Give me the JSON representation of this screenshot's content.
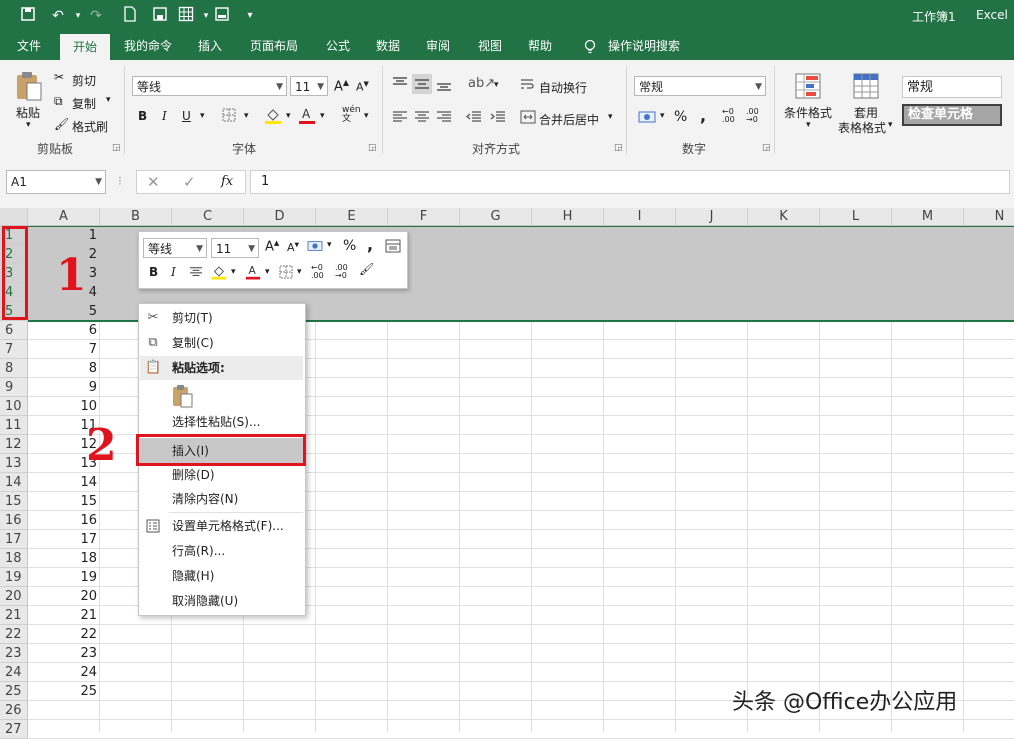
{
  "window": {
    "doc_title": "工作簿1",
    "app_name": "Excel"
  },
  "quick_access": {
    "save": "save",
    "undo": "undo",
    "redo": "redo"
  },
  "tabs": [
    {
      "label": "文件"
    },
    {
      "label": "开始"
    },
    {
      "label": "我的命令"
    },
    {
      "label": "插入"
    },
    {
      "label": "页面布局"
    },
    {
      "label": "公式"
    },
    {
      "label": "数据"
    },
    {
      "label": "审阅"
    },
    {
      "label": "视图"
    },
    {
      "label": "帮助"
    }
  ],
  "tell_me": "操作说明搜索",
  "ribbon": {
    "clipboard": {
      "paste": "粘贴",
      "cut": "剪切",
      "copy": "复制",
      "format_painter": "格式刷",
      "label": "剪贴板"
    },
    "font": {
      "name": "等线",
      "size": "11",
      "bold": "B",
      "italic": "I",
      "underline": "U",
      "label": "字体"
    },
    "alignment": {
      "wrap": "自动换行",
      "merge": "合并后居中",
      "label": "对齐方式"
    },
    "number": {
      "format": "常规",
      "percent": "%",
      "comma": ",",
      "label": "数字"
    },
    "styles": {
      "conditional": "条件格式",
      "table_line1": "套用",
      "table_line2": "表格格式",
      "style_normal": "常规",
      "style_check": "检查单元格"
    }
  },
  "formula_bar": {
    "name_box": "A1",
    "fx": "fx",
    "value": "1"
  },
  "columns": [
    "A",
    "B",
    "C",
    "D",
    "E",
    "F",
    "G",
    "H",
    "I",
    "J",
    "K",
    "L",
    "M",
    "N"
  ],
  "rows": [
    "1",
    "2",
    "3",
    "4",
    "5",
    "6",
    "7",
    "8",
    "9",
    "10",
    "11",
    "12",
    "13",
    "14",
    "15",
    "16",
    "17",
    "18",
    "19",
    "20",
    "21",
    "22",
    "23",
    "24",
    "25",
    "26",
    "27"
  ],
  "col_a_values": [
    "1",
    "2",
    "3",
    "4",
    "5",
    "6",
    "7",
    "8",
    "9",
    "10",
    "11",
    "12",
    "13",
    "14",
    "15",
    "16",
    "17",
    "18",
    "19",
    "20",
    "21",
    "22",
    "23",
    "24",
    "25",
    "",
    ""
  ],
  "mini_toolbar": {
    "font": "等线",
    "size": "11",
    "bold": "B",
    "italic": "I",
    "percent": "%",
    "comma": ","
  },
  "context_menu": {
    "cut": "剪切(T)",
    "copy": "复制(C)",
    "paste_options": "粘贴选项:",
    "paste_special": "选择性粘贴(S)...",
    "insert": "插入(I)",
    "delete": "删除(D)",
    "clear": "清除内容(N)",
    "format_cells": "设置单元格格式(F)...",
    "row_height": "行高(R)...",
    "hide": "隐藏(H)",
    "unhide": "取消隐藏(U)"
  },
  "annotations": {
    "step1": "1",
    "step2": "2",
    "accent": "#e0141e"
  },
  "watermark": "头条 @Office办公应用",
  "colors": {
    "brand": "#217346",
    "selection": "#c8c8c8",
    "annotation": "#e0141e"
  }
}
